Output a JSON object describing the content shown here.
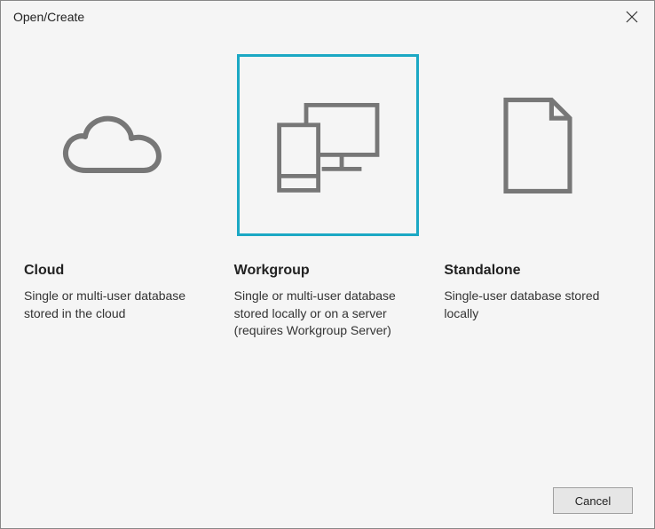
{
  "dialog": {
    "title": "Open/Create",
    "selected_index": 1,
    "options": [
      {
        "icon": "cloud-icon",
        "title": "Cloud",
        "description": "Single or multi-user database stored in the cloud"
      },
      {
        "icon": "workgroup-icon",
        "title": "Workgroup",
        "description": "Single or multi-user database stored locally or on a server (requires Workgroup Server)"
      },
      {
        "icon": "document-icon",
        "title": "Standalone",
        "description": "Single-user database stored locally"
      }
    ],
    "cancel_label": "Cancel"
  }
}
